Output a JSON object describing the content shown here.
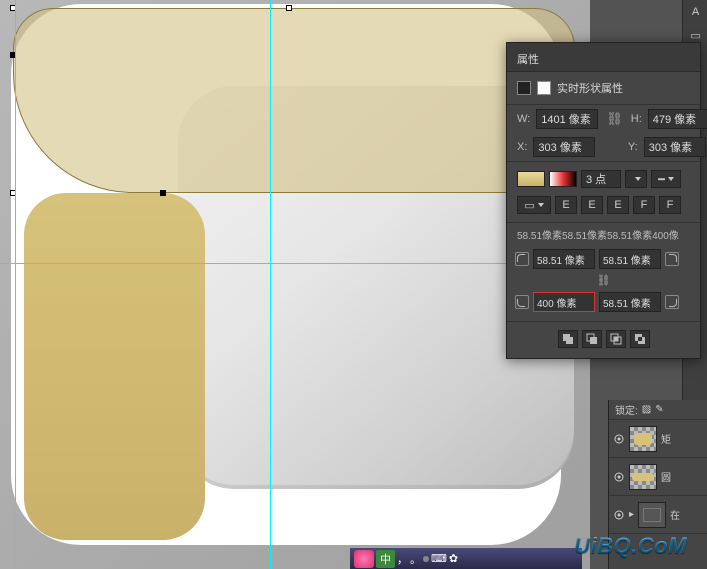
{
  "panel": {
    "tab": "属性",
    "title": "实时形状属性",
    "w_label": "W:",
    "w_value": "1401 像素",
    "h_label": "H:",
    "h_value": "479 像素",
    "x_label": "X:",
    "x_value": "303 像素",
    "y_label": "Y:",
    "y_value": "303 像素",
    "stroke_width": "3 点",
    "corner_summary": "58.51像素58.51像素58.51像素400像",
    "corner_tl": "58.51 像素",
    "corner_tr": "58.51 像素",
    "corner_bl": "400 像素",
    "corner_br": "58.51 像素"
  },
  "colors": {
    "fill": "#d6c27a",
    "highlight": "#d33"
  },
  "layers": {
    "lock_label": "锁定:",
    "items": [
      {
        "name": "矩",
        "type": "shape-gold"
      },
      {
        "name": "圆",
        "type": "shape-gold2"
      },
      {
        "name": "在",
        "type": "folder"
      }
    ]
  },
  "ime": {
    "lang": "中",
    "punct": "，",
    "full": "。"
  },
  "watermark": "UiBQ.CoM",
  "guides": {
    "v1": 15,
    "v2": 270,
    "h1": 263
  }
}
